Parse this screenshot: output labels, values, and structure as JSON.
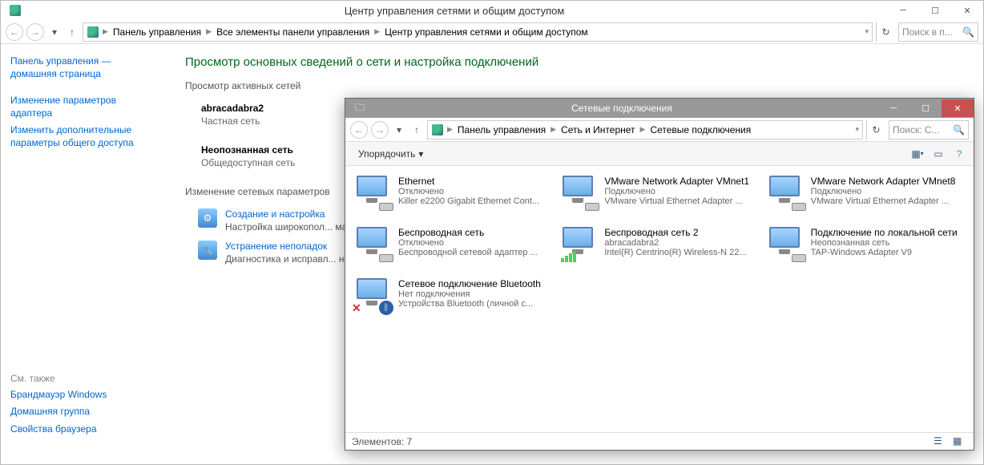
{
  "mainWindow": {
    "title": "Центр управления сетями и общим доступом",
    "breadcrumb": {
      "c1": "Панель управления",
      "c2": "Все элементы панели управления",
      "c3": "Центр управления сетями и общим доступом"
    },
    "searchPlaceholder": "Поиск в п...",
    "sidebar": {
      "home": "Панель управления — домашняя страница",
      "adapter": "Изменение параметров адаптера",
      "sharing": "Изменить дополнительные параметры общего доступа",
      "seeAlso": "См. также",
      "firewall": "Брандмауэр Windows",
      "homegroup": "Домашняя группа",
      "browser": "Свойства браузера"
    },
    "heading": "Просмотр основных сведений о сети и настройка подключений",
    "activeNets": "Просмотр активных сетей",
    "net1": {
      "name": "abracadabra2",
      "type": "Частная сеть"
    },
    "net2": {
      "name": "Неопознанная сеть",
      "type": "Общедоступная сеть"
    },
    "changeHdr": "Изменение сетевых параметров",
    "task1": {
      "link": "Создание и настройка",
      "desc": "Настройка широкопол... маршрутизатора или т..."
    },
    "task2": {
      "link": "Устранение неполадок",
      "desc": "Диагностика и исправл... неполадок."
    }
  },
  "childWindow": {
    "title": "Сетевые подключения",
    "breadcrumb": {
      "c1": "Панель управления",
      "c2": "Сеть и Интернет",
      "c3": "Сетевые подключения"
    },
    "searchPlaceholder": "Поиск: С...",
    "organize": "Упорядочить",
    "conns": [
      {
        "name": "Ethernet",
        "state": "Отключено",
        "dev": "Killer e2200 Gigabit Ethernet Cont..."
      },
      {
        "name": "VMware Network Adapter VMnet1",
        "state": "Подключено",
        "dev": "VMware Virtual Ethernet Adapter ..."
      },
      {
        "name": "VMware Network Adapter VMnet8",
        "state": "Подключено",
        "dev": "VMware Virtual Ethernet Adapter ..."
      },
      {
        "name": "Беспроводная сеть",
        "state": "Отключено",
        "dev": "Беспроводной сетевой адаптер ..."
      },
      {
        "name": "Беспроводная сеть 2",
        "state": "abracadabra2",
        "dev": "Intel(R) Centrino(R) Wireless-N 22..."
      },
      {
        "name": "Подключение по локальной сети",
        "state": "Неопознанная сеть",
        "dev": "TAP-Windows Adapter V9"
      },
      {
        "name": "Сетевое подключение Bluetooth",
        "state": "Нет подключения",
        "dev": "Устройства Bluetooth (личной с..."
      }
    ],
    "status": "Элементов: 7"
  }
}
